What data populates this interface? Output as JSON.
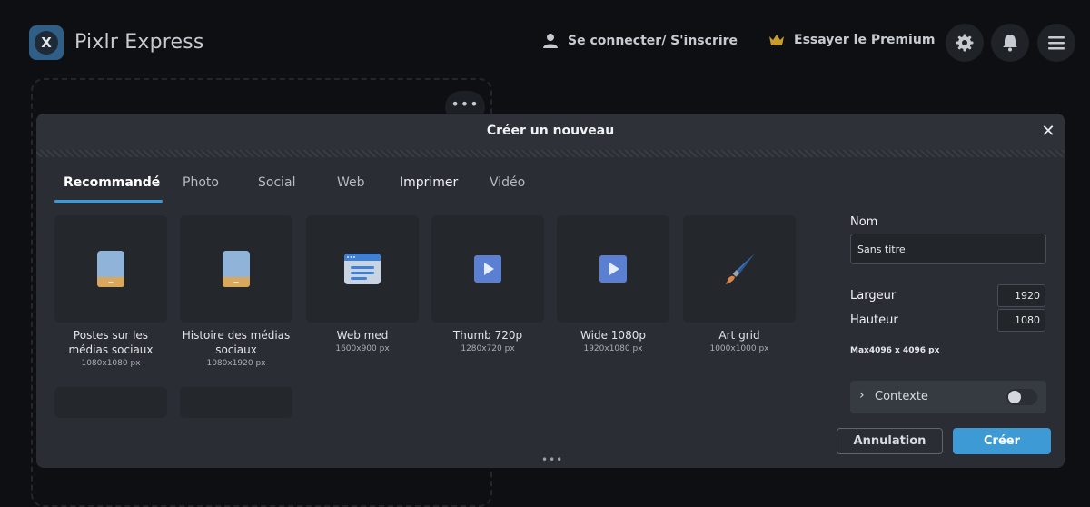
{
  "app": {
    "title": "Pixlr Express"
  },
  "header": {
    "login_label": "Se connecter/ S'inscrire",
    "premium_label": "Essayer le Premium",
    "icons": [
      "user-icon",
      "crown-icon",
      "gear-icon",
      "bell-icon",
      "menu-icon"
    ]
  },
  "background": {
    "more_label": "•••"
  },
  "modal": {
    "title": "Créer un nouveau",
    "close_label": "✕",
    "tabs": [
      {
        "label": "Recommandé",
        "active": true
      },
      {
        "label": "Photo",
        "active": false
      },
      {
        "label": "Social",
        "active": false
      },
      {
        "label": "Web",
        "active": false
      },
      {
        "label": "Imprimer",
        "active": false
      },
      {
        "label": "Vidéo",
        "active": false
      }
    ],
    "templates": [
      {
        "name": "Postes sur les médias sociaux",
        "size": "1080x1080 px",
        "icon": "phone-icon"
      },
      {
        "name": "Histoire des médias sociaux",
        "size": "1080x1920 px",
        "icon": "phone-icon"
      },
      {
        "name": "Web med",
        "size": "1600x900 px",
        "icon": "browser-icon"
      },
      {
        "name": "Thumb 720p",
        "size": "1280x720 px",
        "icon": "play-icon"
      },
      {
        "name": "Wide 1080p",
        "size": "1920x1080 px",
        "icon": "play-icon"
      },
      {
        "name": "Art grid",
        "size": "1000x1000 px",
        "icon": "paintbrush-icon"
      }
    ],
    "settings": {
      "name_label": "Nom",
      "name_value": "Sans titre",
      "width_label": "Largeur",
      "width_value": "1920",
      "height_label": "Hauteur",
      "height_value": "1080",
      "max_note": "Max4096 x 4096 px",
      "context_label": "Contexte",
      "context_enabled": false
    },
    "buttons": {
      "cancel_label": "Annulation",
      "create_label": "Créer"
    },
    "grip_label": "•••"
  },
  "colors": {
    "accent": "#3d9ad5",
    "background": "#0d0f12",
    "modal": "#2a2d33"
  }
}
